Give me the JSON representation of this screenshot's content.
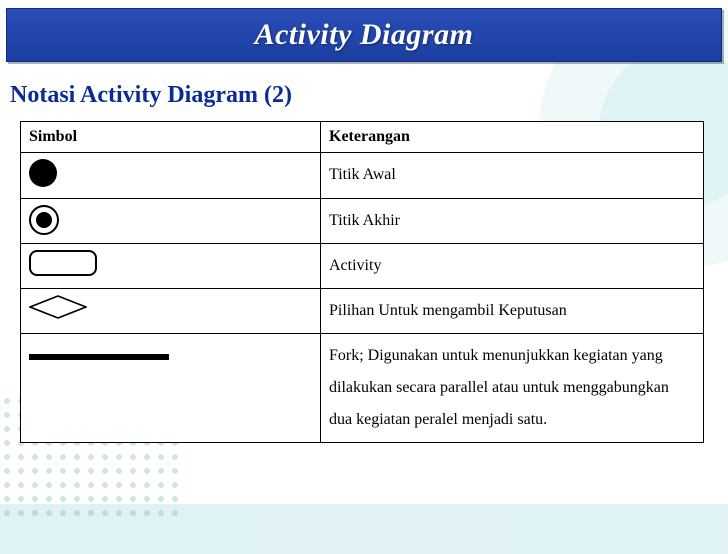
{
  "header": {
    "title": "Activity Diagram"
  },
  "subtitle": "Notasi Activity Diagram (2)",
  "table": {
    "columns": {
      "symbol": "Simbol",
      "description": "Keterangan"
    },
    "rows": [
      {
        "symbol_name": "initial-node",
        "description": "Titik Awal"
      },
      {
        "symbol_name": "final-node",
        "description": "Titik Akhir"
      },
      {
        "symbol_name": "activity-node",
        "description": "Activity"
      },
      {
        "symbol_name": "decision-node",
        "description": "Pilihan Untuk mengambil Keputusan"
      },
      {
        "symbol_name": "fork-bar",
        "description": "Fork; Digunakan untuk menunjukkan kegiatan yang dilakukan secara parallel atau untuk menggabungkan dua kegiatan peralel menjadi satu."
      }
    ]
  }
}
